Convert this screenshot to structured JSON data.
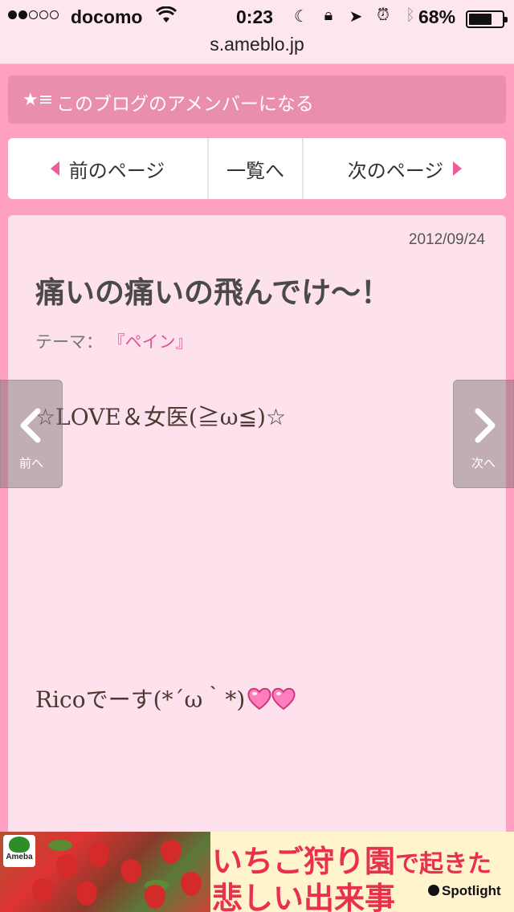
{
  "status_bar": {
    "carrier": "docomo",
    "time": "0:23",
    "battery_percent": "68%",
    "battery_level": 0.68,
    "signal_bars": 2
  },
  "browser": {
    "url": "s.ameblo.jp"
  },
  "amember": {
    "label": "このブログのアメンバーになる"
  },
  "pager": {
    "prev_label": "前のページ",
    "list_label": "一覧へ",
    "next_label": "次のページ"
  },
  "article": {
    "date": "2012/09/24",
    "title": "痛いの痛いの飛んでけ～！",
    "theme_label": "テーマ：",
    "theme_value": "『ペイン』",
    "body_line1": "☆LOVE＆女医(≧ω≦)☆",
    "body_line2": "Ricoでーす(*´ω｀*)"
  },
  "side_nav": {
    "prev_label": "前へ",
    "next_label": "次へ"
  },
  "ad": {
    "brand": "Ameba",
    "headline_part1": "いちご狩り園",
    "headline_part2": "で起きた",
    "headline_line2": "悲しい出来事",
    "sponsor": "Spotlight"
  },
  "colors": {
    "page_bg": "#ff9fc2",
    "accent_pink": "#ee5d9a",
    "article_bg": "#fde1ec",
    "ad_text": "#e8314f"
  }
}
